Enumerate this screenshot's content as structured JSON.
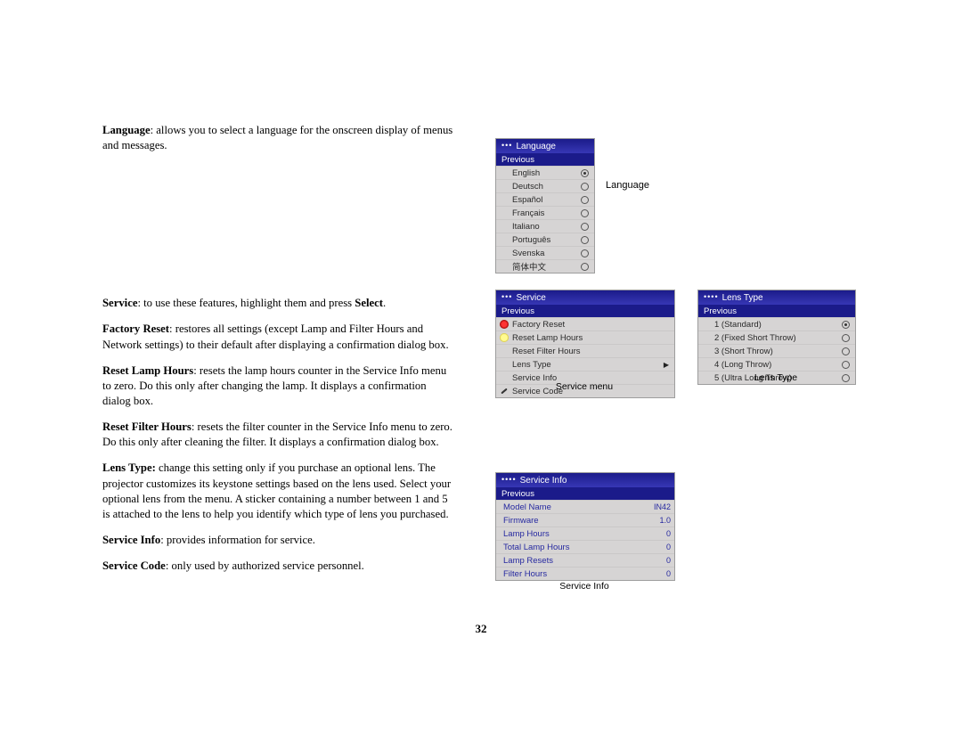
{
  "pageNumber": "32",
  "text": {
    "language": {
      "lead": "Language",
      "body": ": allows you to select a language for the onscreen display of menus and messages."
    },
    "service": {
      "lead": "Service",
      "body": ": to use these features, highlight them and press ",
      "bold2": "Select",
      "tail": "."
    },
    "factoryReset": {
      "lead": "Factory Reset",
      "body": ": restores all settings (except Lamp and Filter Hours and Network settings) to their default after displaying a confirmation dialog box."
    },
    "resetLamp": {
      "lead": "Reset Lamp Hours",
      "body": ": resets the lamp hours counter in the Service Info menu to zero. Do this only after changing the lamp. It displays a confirmation dialog box."
    },
    "resetFilter": {
      "lead": "Reset Filter Hours",
      "body": ": resets the filter counter in the Service Info menu to zero. Do this only after cleaning the filter. It displays a confirmation dialog box."
    },
    "lensType": {
      "lead": "Lens Type:",
      "body": " change this setting only if you purchase an optional lens. The projector customizes its keystone settings based on the lens used. Select your optional lens from the menu. A sticker containing a number between 1 and 5 is attached to the lens to help you identify which type of lens you purchased."
    },
    "serviceInfo": {
      "lead": "Service Info",
      "body": ": provides information for service."
    },
    "serviceCode": {
      "lead": "Service Code",
      "body": ": only used by authorized service personnel."
    }
  },
  "captions": {
    "language": "Language",
    "service": "Service menu",
    "lens": "Lens Type",
    "info": "Service Info"
  },
  "langMenu": {
    "title": "Language",
    "previous": "Previous",
    "items": [
      {
        "label": "English",
        "sel": true
      },
      {
        "label": "Deutsch",
        "sel": false
      },
      {
        "label": "Español",
        "sel": false
      },
      {
        "label": "Français",
        "sel": false
      },
      {
        "label": "Italiano",
        "sel": false
      },
      {
        "label": "Português",
        "sel": false
      },
      {
        "label": "Svenska",
        "sel": false
      },
      {
        "label": "简体中文",
        "sel": false
      }
    ]
  },
  "serviceMenu": {
    "title": "Service",
    "previous": "Previous",
    "items": [
      {
        "label": "Factory Reset",
        "icon": "red"
      },
      {
        "label": "Reset Lamp Hours",
        "icon": "bulb"
      },
      {
        "label": "Reset Filter Hours"
      },
      {
        "label": "Lens Type",
        "submenu": true
      },
      {
        "label": "Service Info"
      },
      {
        "label": "Service Code",
        "icon": "wrench"
      }
    ]
  },
  "lensMenu": {
    "title": "Lens Type",
    "previous": "Previous",
    "items": [
      {
        "label": "1 (Standard)",
        "sel": true
      },
      {
        "label": "2 (Fixed Short Throw)",
        "sel": false
      },
      {
        "label": "3 (Short Throw)",
        "sel": false
      },
      {
        "label": "4 (Long Throw)",
        "sel": false
      },
      {
        "label": "5 (Ultra Long Throw)",
        "sel": false
      }
    ]
  },
  "infoMenu": {
    "title": "Service Info",
    "previous": "Previous",
    "rows": [
      {
        "label": "Model Name",
        "value": "IN42"
      },
      {
        "label": "Firmware",
        "value": "1.0"
      },
      {
        "label": "Lamp Hours",
        "value": "0"
      },
      {
        "label": "Total Lamp Hours",
        "value": "0"
      },
      {
        "label": "Lamp Resets",
        "value": "0"
      },
      {
        "label": "Filter Hours",
        "value": "0"
      }
    ]
  }
}
